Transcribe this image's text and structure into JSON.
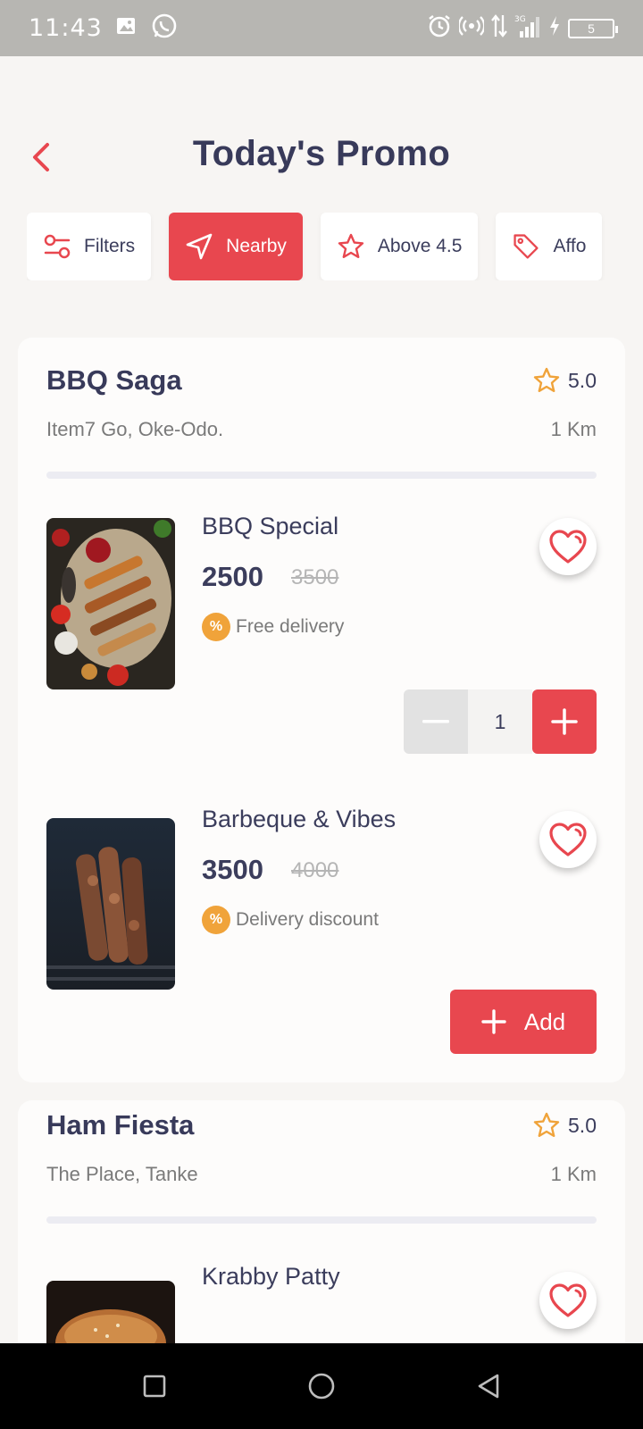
{
  "status_bar": {
    "time": "11:43",
    "battery": "5",
    "icons": [
      "image-icon",
      "whatsapp-icon",
      "alarm-icon",
      "hotspot-icon",
      "data-arrows-icon",
      "signal-3g-icon",
      "charging-icon"
    ]
  },
  "header": {
    "title": "Today's Promo",
    "back_icon": "chevron-left-icon"
  },
  "filters": [
    {
      "label": "Filters",
      "icon": "sliders-icon",
      "active": false
    },
    {
      "label": "Nearby",
      "icon": "navigation-icon",
      "active": true
    },
    {
      "label": "Above 4.5",
      "icon": "star-icon",
      "active": false
    },
    {
      "label": "Affo",
      "icon": "tag-icon",
      "active": false
    }
  ],
  "restaurants": [
    {
      "name": "BBQ Saga",
      "rating": "5.0",
      "address": "Item7 Go, Oke-Odo.",
      "distance": "1 Km",
      "dishes": [
        {
          "name": "BBQ Special",
          "price": "2500",
          "old_price": "3500",
          "promo_icon": "%",
          "promo": "Free delivery",
          "quantity": "1"
        },
        {
          "name": "Barbeque & Vibes",
          "price": "3500",
          "old_price": "4000",
          "promo_icon": "%",
          "promo": "Delivery discount",
          "add_label": "Add"
        }
      ]
    },
    {
      "name": "Ham Fiesta",
      "rating": "5.0",
      "address": "The Place, Tanke",
      "distance": "1 Km",
      "dishes": [
        {
          "name": "Krabby Patty"
        }
      ]
    }
  ],
  "colors": {
    "accent": "#e8474f",
    "promo_badge": "#f0a33a",
    "star": "#f0a33a",
    "text": "#3b3d5c",
    "background": "#f7f5f3"
  },
  "nav": [
    "square-icon",
    "circle-icon",
    "back-triangle-icon"
  ]
}
